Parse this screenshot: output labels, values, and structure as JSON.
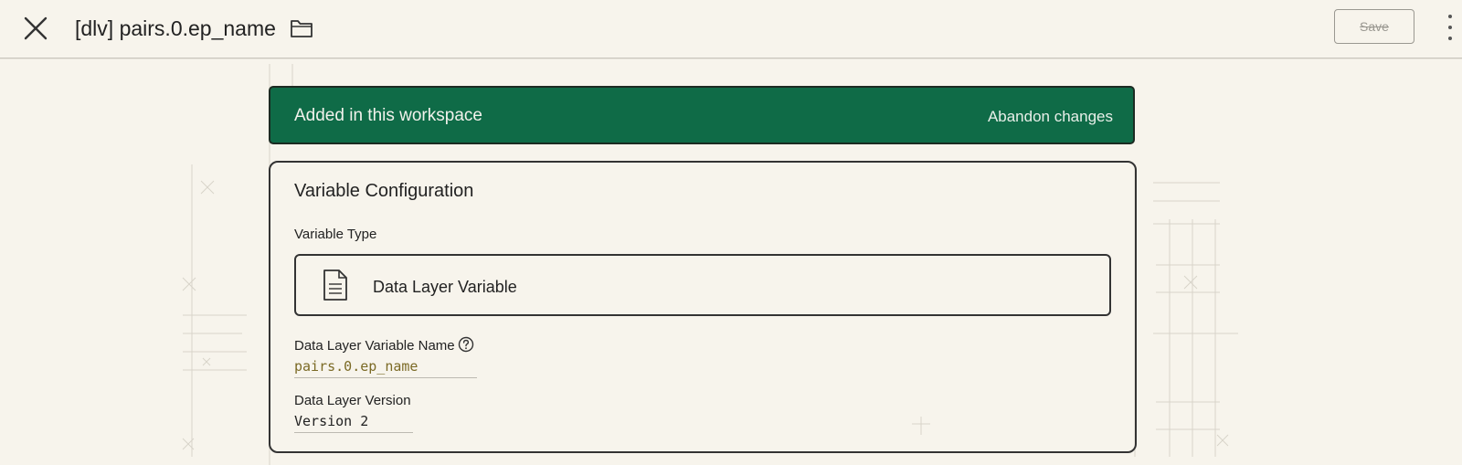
{
  "header": {
    "title": "[dlv] pairs.0.ep_name",
    "save_label": "Save"
  },
  "banner": {
    "text": "Added in this workspace",
    "abandon_label": "Abandon changes",
    "color": "#0f6b47"
  },
  "card": {
    "title": "Variable Configuration",
    "variable_type_label": "Variable Type",
    "variable_type_value": "Data Layer Variable",
    "dlv_name_label": "Data Layer Variable Name",
    "dlv_name_value": "pairs.0.ep_name",
    "version_label": "Data Layer Version",
    "version_value": "Version 2"
  },
  "icons": {
    "close": "close-icon",
    "folder": "folder-icon",
    "more": "more-vertical-icon",
    "document": "document-icon",
    "help": "help-icon"
  }
}
